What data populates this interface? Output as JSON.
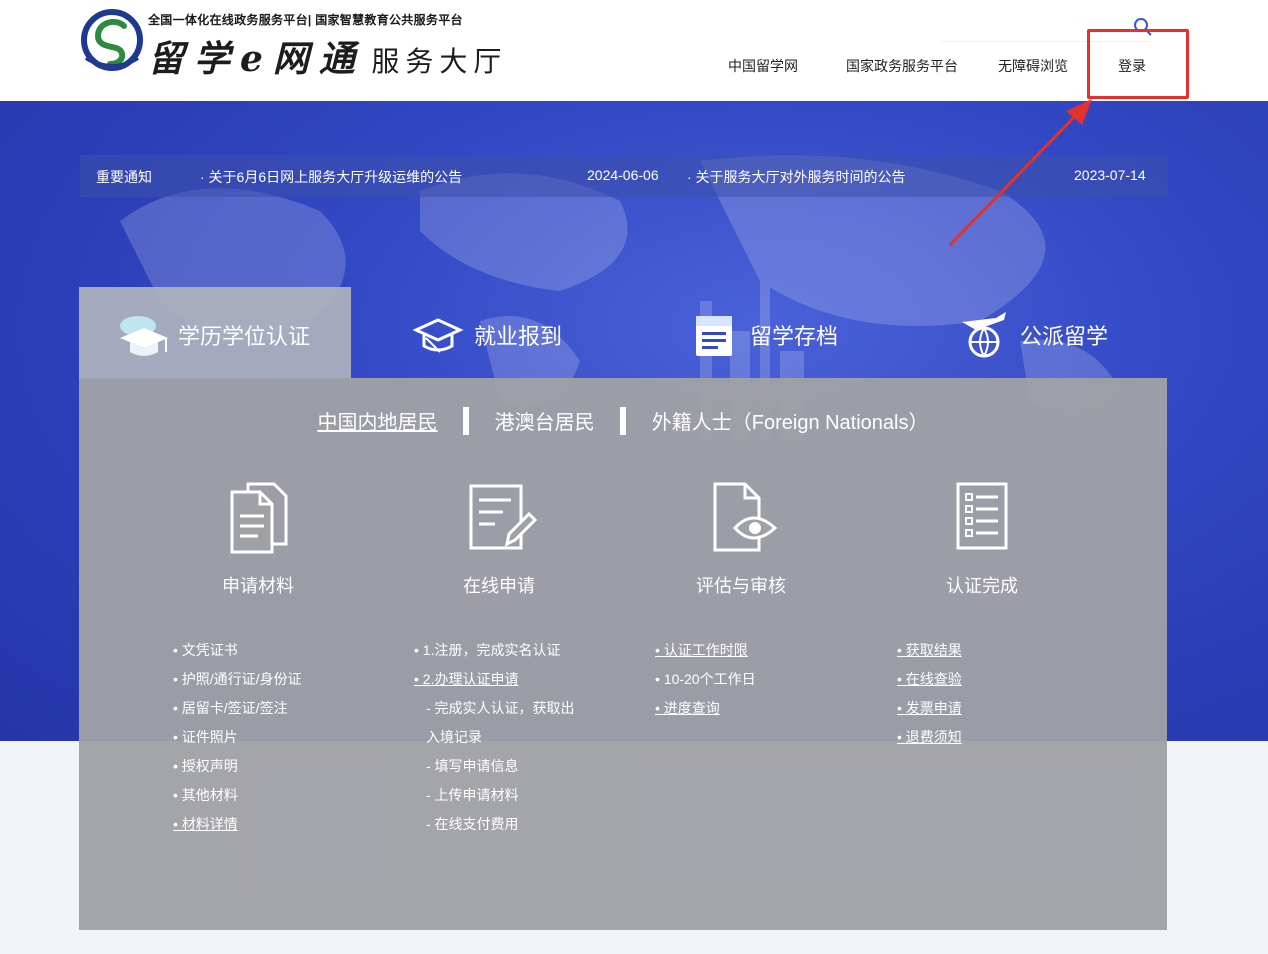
{
  "header": {
    "platform_subtitle": "全国一体化在线政务服务平台| 国家智慧教育公共服务平台",
    "brand_name": "留学e网通",
    "brand_suffix": "服务大厅",
    "nav": [
      {
        "label": "中国留学网"
      },
      {
        "label": "国家政务服务平台"
      },
      {
        "label": "无障碍浏览"
      },
      {
        "label": "登录"
      }
    ],
    "search_icon": "search-icon"
  },
  "notices": {
    "heading": "重要通知",
    "items": [
      {
        "title": "· 关于6月6日网上服务大厅升级运维的公告",
        "date": "2024-06-06"
      },
      {
        "title": "· 关于服务大厅对外服务时间的公告",
        "date": "2023-07-14"
      }
    ]
  },
  "service_tabs": [
    {
      "label": "学历学位认证",
      "icon": "graduation-cap-icon",
      "active": true
    },
    {
      "label": "就业报到",
      "icon": "employment-cap-icon",
      "active": false
    },
    {
      "label": "留学存档",
      "icon": "archive-folder-icon",
      "active": false
    },
    {
      "label": "公派留学",
      "icon": "airplane-globe-icon",
      "active": false
    }
  ],
  "resident_tabs": [
    {
      "label": "中国内地居民",
      "active": true
    },
    {
      "label": "港澳台居民",
      "active": false
    },
    {
      "label": "外籍人士（Foreign Nationals）",
      "active": false
    }
  ],
  "steps": [
    {
      "label": "申请材料",
      "icon": "documents-icon",
      "items": [
        {
          "text": "• 文凭证书",
          "link": false,
          "sub": false
        },
        {
          "text": "• 护照/通行证/身份证",
          "link": false,
          "sub": false
        },
        {
          "text": "• 居留卡/签证/签注",
          "link": false,
          "sub": false
        },
        {
          "text": "• 证件照片",
          "link": false,
          "sub": false
        },
        {
          "text": "• 授权声明",
          "link": false,
          "sub": false
        },
        {
          "text": "• 其他材料",
          "link": false,
          "sub": false
        },
        {
          "text": "• 材料详情",
          "link": true,
          "sub": false
        }
      ]
    },
    {
      "label": "在线申请",
      "icon": "form-edit-icon",
      "items": [
        {
          "text": "• 1.注册，完成实名认证",
          "link": false,
          "sub": false
        },
        {
          "text": "• 2.办理认证申请",
          "link": true,
          "sub": false
        },
        {
          "text": "- 完成实人认证，获取出",
          "link": false,
          "sub": true
        },
        {
          "text": "入境记录",
          "link": false,
          "sub": true
        },
        {
          "text": "- 填写申请信息",
          "link": false,
          "sub": true
        },
        {
          "text": "- 上传申请材料",
          "link": false,
          "sub": true
        },
        {
          "text": "- 在线支付费用",
          "link": false,
          "sub": true
        }
      ]
    },
    {
      "label": "评估与审核",
      "icon": "document-eye-icon",
      "items": [
        {
          "text": "• 认证工作时限",
          "link": true,
          "sub": false
        },
        {
          "text": "• 10-20个工作日",
          "link": false,
          "sub": false
        },
        {
          "text": "• 进度查询",
          "link": true,
          "sub": false
        }
      ]
    },
    {
      "label": "认证完成",
      "icon": "checklist-icon",
      "items": [
        {
          "text": "• 获取结果",
          "link": true,
          "sub": false
        },
        {
          "text": "• 在线查验",
          "link": true,
          "sub": false
        },
        {
          "text": "• 发票申请",
          "link": true,
          "sub": false
        },
        {
          "text": "• 退费须知",
          "link": true,
          "sub": false
        }
      ]
    }
  ],
  "colors": {
    "hero_blue": "#3348c4",
    "panel_gray": "#a0a1a6",
    "annotation_red": "#e3312b"
  }
}
